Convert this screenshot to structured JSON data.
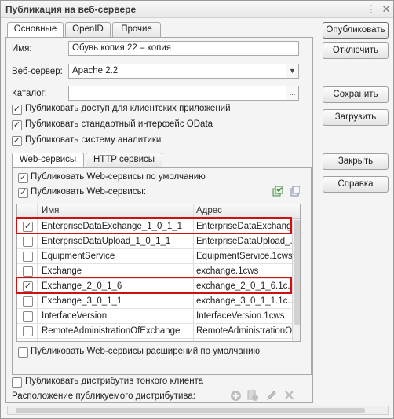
{
  "window": {
    "title": "Публикация на веб-сервере"
  },
  "tabs": [
    {
      "label": "Основные",
      "active": true
    },
    {
      "label": "OpenID",
      "active": false
    },
    {
      "label": "Прочие",
      "active": false
    }
  ],
  "form": {
    "name_label": "Имя:",
    "name_value": "Обувь копия 22 – копия",
    "webserver_label": "Веб-сервер:",
    "webserver_value": "Apache 2.2",
    "catalog_label": "Каталог:",
    "catalog_value": "",
    "dots": "..."
  },
  "options": [
    {
      "label": "Публиковать доступ для клиентских приложений",
      "checked": true
    },
    {
      "label": "Публиковать стандартный интерфейс OData",
      "checked": true
    },
    {
      "label": "Публиковать систему аналитики",
      "checked": true
    }
  ],
  "inner_tabs": [
    {
      "label": "Web-сервисы",
      "active": true
    },
    {
      "label": "HTTP сервисы",
      "active": false
    }
  ],
  "webservices": {
    "default_label": "Публиковать Web-сервисы по умолчанию",
    "default_checked": true,
    "publish_label": "Публиковать Web-сервисы:",
    "publish_checked": true,
    "columns": {
      "name": "Имя",
      "address": "Адрес"
    },
    "rows": [
      {
        "checked": true,
        "name": "EnterpriseDataExchange_1_0_1_1",
        "address": "EnterpriseDataExchang...",
        "highlight": true
      },
      {
        "checked": false,
        "name": "EnterpriseDataUpload_1_0_1_1",
        "address": "EnterpriseDataUpload_...",
        "highlight": false
      },
      {
        "checked": false,
        "name": "EquipmentService",
        "address": "EquipmentService.1cws",
        "highlight": false
      },
      {
        "checked": false,
        "name": "Exchange",
        "address": "exchange.1cws",
        "highlight": false
      },
      {
        "checked": true,
        "name": "Exchange_2_0_1_6",
        "address": "exchange_2_0_1_6.1c...",
        "highlight": true
      },
      {
        "checked": false,
        "name": "Exchange_3_0_1_1",
        "address": "exchange_3_0_1_1.1c...",
        "highlight": false
      },
      {
        "checked": false,
        "name": "InterfaceVersion",
        "address": "InterfaceVersion.1cws",
        "highlight": false
      },
      {
        "checked": false,
        "name": "RemoteAdministrationOfExchange",
        "address": "RemoteAdministrationOf...",
        "highlight": false
      }
    ],
    "extensions_label": "Публиковать Web-сервисы расширений по умолчанию",
    "extensions_checked": false
  },
  "bottom": {
    "thin_client_label": "Публиковать дистрибутив тонкого клиента",
    "thin_client_checked": false,
    "location_label": "Расположение публикуемого дистрибутива:"
  },
  "buttons": {
    "publish": "Опубликовать",
    "unpublish": "Отключить",
    "save": "Сохранить",
    "load": "Загрузить",
    "close": "Закрыть",
    "help": "Справка"
  },
  "colors": {
    "highlight": "#d01010",
    "panel": "#f4f4f4",
    "border": "#a8a8a8"
  }
}
